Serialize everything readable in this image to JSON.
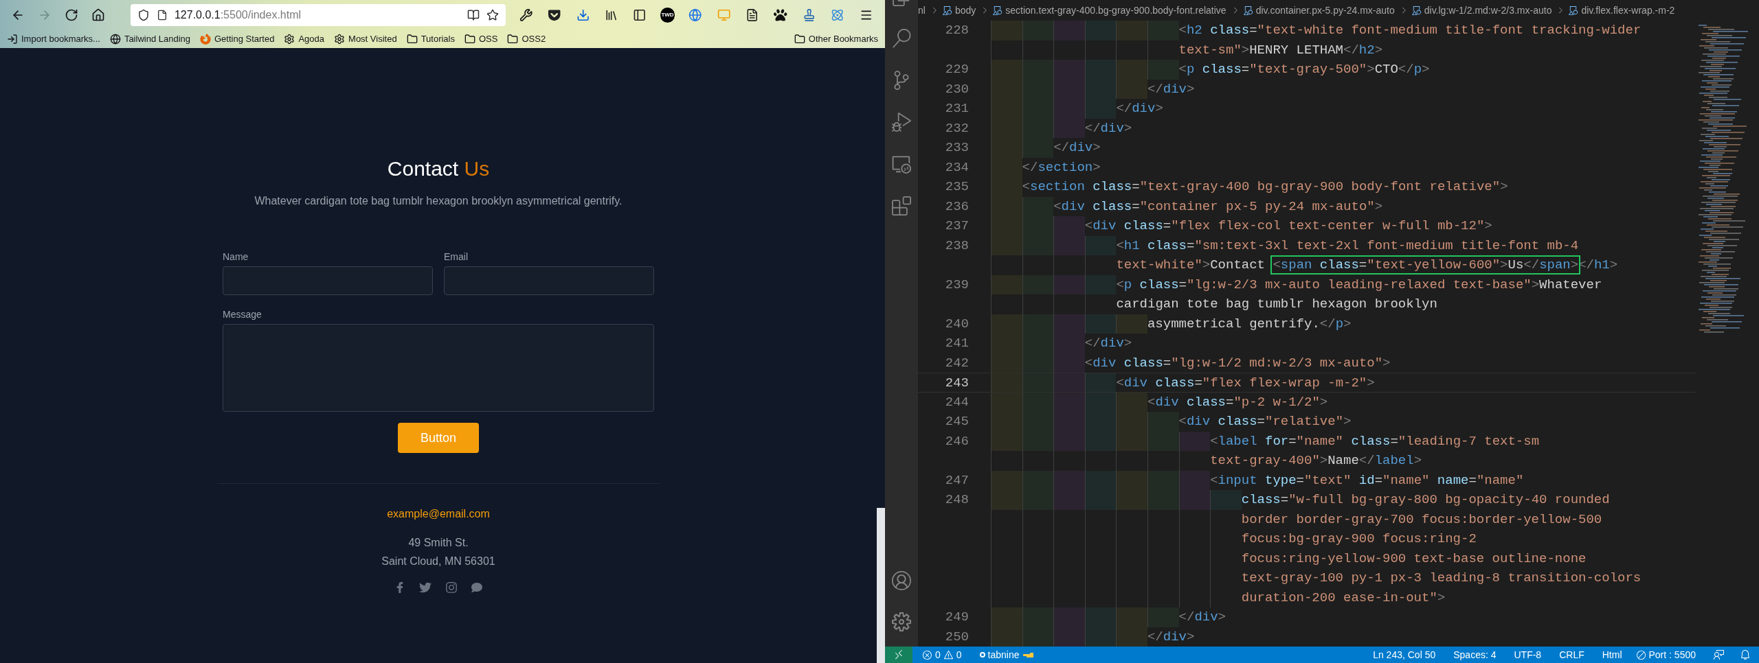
{
  "browser": {
    "nav_buttons": [
      {
        "kind": "back",
        "disabled": false
      },
      {
        "kind": "forward",
        "disabled": true
      },
      {
        "kind": "reload",
        "disabled": false
      },
      {
        "kind": "home",
        "disabled": false
      }
    ],
    "url": {
      "host": "127.0.0.1",
      "rest": ":5500/index.html"
    },
    "extension_badge": "TWD",
    "bookmarks": [
      {
        "label": "Import bookmarks...",
        "kind": "import"
      },
      {
        "label": "Tailwind Landing",
        "kind": "globe"
      },
      {
        "label": "Getting Started",
        "kind": "firefox"
      },
      {
        "label": "Agoda",
        "kind": "gear"
      },
      {
        "label": "Most Visited",
        "kind": "gear"
      },
      {
        "label": "Tutorials",
        "kind": "folder"
      },
      {
        "label": "OSS",
        "kind": "folder"
      },
      {
        "label": "OSS2",
        "kind": "folder"
      }
    ],
    "other_bookmarks": "Other Bookmarks"
  },
  "page": {
    "title": "Contact",
    "title_accent": "Us",
    "subtitle": "Whatever cardigan tote bag tumblr hexagon brooklyn asymmetrical gentrify.",
    "fields": [
      {
        "label": "Name",
        "kind": "input"
      },
      {
        "label": "Email",
        "kind": "input"
      },
      {
        "label": "Message",
        "kind": "textarea"
      }
    ],
    "button": "Button",
    "email": "example@email.com",
    "address": [
      "49 Smith St.",
      "Saint Cloud, MN 56301"
    ],
    "social": [
      {
        "kind": "facebook"
      },
      {
        "kind": "twitter"
      },
      {
        "kind": "instagram"
      },
      {
        "kind": "chat"
      }
    ]
  },
  "editor": {
    "breadcrumbs": [
      {
        "label": "nl",
        "kind": "plain"
      },
      {
        "label": "body",
        "kind": "element"
      },
      {
        "label": "section.text-gray-400.bg-gray-900.body-font.relative",
        "kind": "element"
      },
      {
        "label": "div.container.px-5.py-24.mx-auto",
        "kind": "element"
      },
      {
        "label": "div.lg:w-1/2.md:w-2/3.mx-auto",
        "kind": "element"
      },
      {
        "label": "div.flex.flex-wrap.-m-2",
        "kind": "element"
      }
    ],
    "rows": [
      {
        "number": "228",
        "current": false,
        "ws": "                        ",
        "tokens": [
          {
            "kind": "punct",
            "text": "<"
          },
          {
            "kind": "tag",
            "text": "h2"
          },
          {
            "kind": "attr",
            "text": " class"
          },
          {
            "kind": "op",
            "text": "="
          },
          {
            "kind": "str",
            "text": "\"text-white font-medium title-font tracking-wider"
          }
        ]
      },
      {
        "current": false,
        "ws": "                        ",
        "tokens": [
          {
            "kind": "str",
            "text": "text-sm\""
          },
          {
            "kind": "punct",
            "text": ">"
          },
          {
            "kind": "text",
            "text": "HENRY LETHAM"
          },
          {
            "kind": "punct",
            "text": "</"
          },
          {
            "kind": "tag",
            "text": "h2"
          },
          {
            "kind": "punct",
            "text": ">"
          }
        ]
      },
      {
        "number": "229",
        "current": false,
        "ws": "                        ",
        "tokens": [
          {
            "kind": "punct",
            "text": "<"
          },
          {
            "kind": "tag",
            "text": "p"
          },
          {
            "kind": "attr",
            "text": " class"
          },
          {
            "kind": "op",
            "text": "="
          },
          {
            "kind": "str",
            "text": "\"text-gray-500\""
          },
          {
            "kind": "punct",
            "text": ">"
          },
          {
            "kind": "text",
            "text": "CTO"
          },
          {
            "kind": "punct",
            "text": "</"
          },
          {
            "kind": "tag",
            "text": "p"
          },
          {
            "kind": "punct",
            "text": ">"
          }
        ]
      },
      {
        "number": "230",
        "current": false,
        "ws": "                    ",
        "tokens": [
          {
            "kind": "punct",
            "text": "</"
          },
          {
            "kind": "tag",
            "text": "div"
          },
          {
            "kind": "punct",
            "text": ">"
          }
        ]
      },
      {
        "number": "231",
        "current": false,
        "ws": "                ",
        "tokens": [
          {
            "kind": "punct",
            "text": "</"
          },
          {
            "kind": "tag",
            "text": "div"
          },
          {
            "kind": "punct",
            "text": ">"
          }
        ]
      },
      {
        "number": "232",
        "current": false,
        "ws": "            ",
        "tokens": [
          {
            "kind": "punct",
            "text": "</"
          },
          {
            "kind": "tag",
            "text": "div"
          },
          {
            "kind": "punct",
            "text": ">"
          }
        ]
      },
      {
        "number": "233",
        "current": false,
        "ws": "        ",
        "tokens": [
          {
            "kind": "punct",
            "text": "</"
          },
          {
            "kind": "tag",
            "text": "div"
          },
          {
            "kind": "punct",
            "text": ">"
          }
        ]
      },
      {
        "number": "234",
        "current": false,
        "ws": "    ",
        "tokens": [
          {
            "kind": "punct",
            "text": "</"
          },
          {
            "kind": "tag",
            "text": "section"
          },
          {
            "kind": "punct",
            "text": ">"
          }
        ]
      },
      {
        "number": "235",
        "current": false,
        "ws": "    ",
        "tokens": [
          {
            "kind": "punct",
            "text": "<"
          },
          {
            "kind": "tag",
            "text": "section"
          },
          {
            "kind": "attr",
            "text": " class"
          },
          {
            "kind": "op",
            "text": "="
          },
          {
            "kind": "str",
            "text": "\"text-gray-400 bg-gray-900 body-font relative\""
          },
          {
            "kind": "punct",
            "text": ">"
          }
        ]
      },
      {
        "number": "236",
        "current": false,
        "ws": "        ",
        "tokens": [
          {
            "kind": "punct",
            "text": "<"
          },
          {
            "kind": "tag",
            "text": "div"
          },
          {
            "kind": "attr",
            "text": " class"
          },
          {
            "kind": "op",
            "text": "="
          },
          {
            "kind": "str",
            "text": "\"container px-5 py-24 mx-auto\""
          },
          {
            "kind": "punct",
            "text": ">"
          }
        ]
      },
      {
        "number": "237",
        "current": false,
        "ws": "            ",
        "tokens": [
          {
            "kind": "punct",
            "text": "<"
          },
          {
            "kind": "tag",
            "text": "div"
          },
          {
            "kind": "attr",
            "text": " class"
          },
          {
            "kind": "op",
            "text": "="
          },
          {
            "kind": "str",
            "text": "\"flex flex-col text-center w-full mb-12\""
          },
          {
            "kind": "punct",
            "text": ">"
          }
        ]
      },
      {
        "number": "238",
        "current": false,
        "ws": "                ",
        "tokens": [
          {
            "kind": "punct",
            "text": "<"
          },
          {
            "kind": "tag",
            "text": "h1"
          },
          {
            "kind": "attr",
            "text": " class"
          },
          {
            "kind": "op",
            "text": "="
          },
          {
            "kind": "str",
            "text": "\"sm:text-3xl text-2xl font-medium title-font mb-4"
          }
        ]
      },
      {
        "current": false,
        "ws": "                ",
        "tokens": [
          {
            "kind": "str",
            "text": "text-white\""
          },
          {
            "kind": "punct",
            "text": ">"
          },
          {
            "kind": "text",
            "text": "Contact "
          },
          {
            "kind": "group",
            "boxed": true,
            "tokens": [
              {
                "kind": "punct",
                "text": "<"
              },
              {
                "kind": "tag",
                "text": "span"
              },
              {
                "kind": "attr",
                "text": " class"
              },
              {
                "kind": "op",
                "text": "="
              },
              {
                "kind": "str",
                "text": "\"text-yellow-600\""
              },
              {
                "kind": "punct",
                "text": ">"
              },
              {
                "kind": "text",
                "text": "Us"
              },
              {
                "kind": "punct",
                "text": "</"
              },
              {
                "kind": "tag",
                "text": "span"
              },
              {
                "kind": "punct",
                "text": ">"
              }
            ]
          },
          {
            "kind": "punct",
            "text": "</"
          },
          {
            "kind": "tag",
            "text": "h1"
          },
          {
            "kind": "punct",
            "text": ">"
          }
        ]
      },
      {
        "number": "239",
        "current": false,
        "ws": "                ",
        "tokens": [
          {
            "kind": "punct",
            "text": "<"
          },
          {
            "kind": "tag",
            "text": "p"
          },
          {
            "kind": "attr",
            "text": " class"
          },
          {
            "kind": "op",
            "text": "="
          },
          {
            "kind": "str",
            "text": "\"lg:w-2/3 mx-auto leading-relaxed text-base\""
          },
          {
            "kind": "punct",
            "text": ">"
          },
          {
            "kind": "text",
            "text": "Whatever"
          }
        ]
      },
      {
        "current": false,
        "ws": "                ",
        "tokens": [
          {
            "kind": "text",
            "text": "cardigan tote bag tumblr hexagon brooklyn"
          }
        ]
      },
      {
        "number": "240",
        "current": false,
        "ws": "                    ",
        "tokens": [
          {
            "kind": "text",
            "text": "asymmetrical gentrify."
          },
          {
            "kind": "punct",
            "text": "</"
          },
          {
            "kind": "tag",
            "text": "p"
          },
          {
            "kind": "punct",
            "text": ">"
          }
        ]
      },
      {
        "number": "241",
        "current": false,
        "ws": "            ",
        "tokens": [
          {
            "kind": "punct",
            "text": "</"
          },
          {
            "kind": "tag",
            "text": "div"
          },
          {
            "kind": "punct",
            "text": ">"
          }
        ]
      },
      {
        "number": "242",
        "current": false,
        "ws": "            ",
        "tokens": [
          {
            "kind": "punct",
            "text": "<"
          },
          {
            "kind": "tag",
            "text": "div"
          },
          {
            "kind": "attr",
            "text": " class"
          },
          {
            "kind": "op",
            "text": "="
          },
          {
            "kind": "str",
            "text": "\"lg:w-1/2 md:w-2/3 mx-auto\""
          },
          {
            "kind": "punct",
            "text": ">"
          }
        ]
      },
      {
        "number": "243",
        "current": true,
        "ws": "                ",
        "tokens": [
          {
            "kind": "punct",
            "text": "<"
          },
          {
            "kind": "tag",
            "text": "div"
          },
          {
            "kind": "attr",
            "text": " class"
          },
          {
            "kind": "op",
            "text": "="
          },
          {
            "kind": "str",
            "text": "\"flex flex-wrap -m-2\""
          },
          {
            "kind": "punct",
            "text": ">"
          }
        ]
      },
      {
        "number": "244",
        "current": false,
        "ws": "                    ",
        "tokens": [
          {
            "kind": "punct",
            "text": "<"
          },
          {
            "kind": "tag",
            "text": "div"
          },
          {
            "kind": "attr",
            "text": " class"
          },
          {
            "kind": "op",
            "text": "="
          },
          {
            "kind": "str",
            "text": "\"p-2 w-1/2\""
          },
          {
            "kind": "punct",
            "text": ">"
          }
        ]
      },
      {
        "number": "245",
        "current": false,
        "ws": "                        ",
        "tokens": [
          {
            "kind": "punct",
            "text": "<"
          },
          {
            "kind": "tag",
            "text": "div"
          },
          {
            "kind": "attr",
            "text": " class"
          },
          {
            "kind": "op",
            "text": "="
          },
          {
            "kind": "str",
            "text": "\"relative\""
          },
          {
            "kind": "punct",
            "text": ">"
          }
        ]
      },
      {
        "number": "246",
        "current": false,
        "ws": "                            ",
        "tokens": [
          {
            "kind": "punct",
            "text": "<"
          },
          {
            "kind": "tag",
            "text": "label"
          },
          {
            "kind": "attr",
            "text": " for"
          },
          {
            "kind": "op",
            "text": "="
          },
          {
            "kind": "str",
            "text": "\"name\""
          },
          {
            "kind": "attr",
            "text": " class"
          },
          {
            "kind": "op",
            "text": "="
          },
          {
            "kind": "str",
            "text": "\"leading-7 text-sm"
          }
        ]
      },
      {
        "current": false,
        "ws": "                            ",
        "tokens": [
          {
            "kind": "str",
            "text": "text-gray-400\""
          },
          {
            "kind": "punct",
            "text": ">"
          },
          {
            "kind": "text",
            "text": "Name"
          },
          {
            "kind": "punct",
            "text": "</"
          },
          {
            "kind": "tag",
            "text": "label"
          },
          {
            "kind": "punct",
            "text": ">"
          }
        ]
      },
      {
        "number": "247",
        "current": false,
        "ws": "                            ",
        "tokens": [
          {
            "kind": "punct",
            "text": "<"
          },
          {
            "kind": "tag",
            "text": "input"
          },
          {
            "kind": "attr",
            "text": " type"
          },
          {
            "kind": "op",
            "text": "="
          },
          {
            "kind": "str",
            "text": "\"text\""
          },
          {
            "kind": "attr",
            "text": " id"
          },
          {
            "kind": "op",
            "text": "="
          },
          {
            "kind": "str",
            "text": "\"name\""
          },
          {
            "kind": "attr",
            "text": " name"
          },
          {
            "kind": "op",
            "text": "="
          },
          {
            "kind": "str",
            "text": "\"name\""
          }
        ]
      },
      {
        "number": "248",
        "current": false,
        "ws": "                                ",
        "tokens": [
          {
            "kind": "attr",
            "text": "class"
          },
          {
            "kind": "op",
            "text": "="
          },
          {
            "kind": "str",
            "text": "\"w-full bg-gray-800 bg-opacity-40 rounded"
          }
        ]
      },
      {
        "current": false,
        "ws": "                                ",
        "tokens": [
          {
            "kind": "str",
            "text": "border border-gray-700 focus:border-yellow-500"
          }
        ]
      },
      {
        "current": false,
        "ws": "                                ",
        "tokens": [
          {
            "kind": "str",
            "text": "focus:bg-gray-900 focus:ring-2"
          }
        ]
      },
      {
        "current": false,
        "ws": "                                ",
        "tokens": [
          {
            "kind": "str",
            "text": "focus:ring-yellow-900 text-base outline-none"
          }
        ]
      },
      {
        "current": false,
        "ws": "                                ",
        "tokens": [
          {
            "kind": "str",
            "text": "text-gray-100 py-1 px-3 leading-8 transition-colors"
          }
        ]
      },
      {
        "current": false,
        "ws": "                                ",
        "tokens": [
          {
            "kind": "str",
            "text": "duration-200 ease-in-out\""
          },
          {
            "kind": "punct",
            "text": ">"
          }
        ]
      },
      {
        "number": "249",
        "current": false,
        "ws": "                        ",
        "tokens": [
          {
            "kind": "punct",
            "text": "</"
          },
          {
            "kind": "tag",
            "text": "div"
          },
          {
            "kind": "punct",
            "text": ">"
          }
        ]
      },
      {
        "number": "250",
        "current": false,
        "ws": "                    ",
        "tokens": [
          {
            "kind": "punct",
            "text": "</"
          },
          {
            "kind": "tag",
            "text": "div"
          },
          {
            "kind": "punct",
            "text": ">"
          }
        ]
      }
    ],
    "status_bar": {
      "errors": "0",
      "warnings": "0",
      "tabnine": "tabnine",
      "position": "Ln 243, Col 50",
      "spaces": "Spaces: 4",
      "encoding": "UTF-8",
      "eol": "CRLF",
      "language": "Html",
      "port": "Port : 5500"
    }
  }
}
